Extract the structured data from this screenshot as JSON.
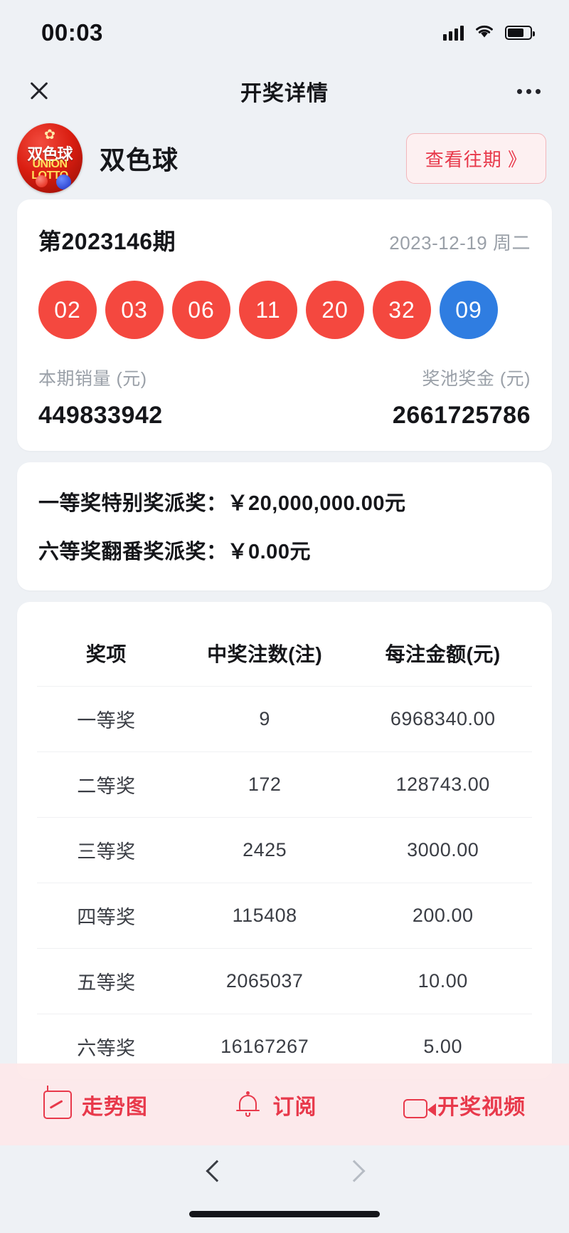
{
  "status_bar": {
    "time": "00:03",
    "signal_icon": "signal-bars-icon",
    "wifi_icon": "wifi-icon",
    "battery_icon": "battery-icon"
  },
  "nav": {
    "title": "开奖详情",
    "close_icon": "close-icon",
    "more_icon": "more-options-icon"
  },
  "brand": {
    "logo_star": "✿",
    "logo_cn": "双色球",
    "logo_en_line1": "UNION",
    "logo_en_line2": "LOTTO",
    "name": "双色球",
    "history_button": "查看往期 》"
  },
  "draw": {
    "issue": "第2023146期",
    "date": "2023-12-19 周二",
    "balls": [
      {
        "number": "02",
        "color": "red"
      },
      {
        "number": "03",
        "color": "red"
      },
      {
        "number": "06",
        "color": "red"
      },
      {
        "number": "11",
        "color": "red"
      },
      {
        "number": "20",
        "color": "red"
      },
      {
        "number": "32",
        "color": "red"
      },
      {
        "number": "09",
        "color": "blue"
      }
    ],
    "sales_label": "本期销量 (元)",
    "sales_value": "449833942",
    "pool_label": "奖池奖金 (元)",
    "pool_value": "2661725786"
  },
  "bonus": {
    "line1": "一等奖特别奖派奖：￥20,000,000.00元",
    "line2": "六等奖翻番奖派奖：￥0.00元"
  },
  "prize_table": {
    "headers": [
      "奖项",
      "中奖注数(注)",
      "每注金额(元)"
    ],
    "rows": [
      {
        "level": "一等奖",
        "count": "9",
        "amount": "6968340.00"
      },
      {
        "level": "二等奖",
        "count": "172",
        "amount": "128743.00"
      },
      {
        "level": "三等奖",
        "count": "2425",
        "amount": "3000.00"
      },
      {
        "level": "四等奖",
        "count": "115408",
        "amount": "200.00"
      },
      {
        "level": "五等奖",
        "count": "2065037",
        "amount": "10.00"
      },
      {
        "level": "六等奖",
        "count": "16167267",
        "amount": "5.00"
      }
    ]
  },
  "tabbar": {
    "items": [
      {
        "label": "走势图",
        "icon": "chart-icon"
      },
      {
        "label": "订阅",
        "icon": "bell-icon"
      },
      {
        "label": "开奖视频",
        "icon": "video-icon"
      }
    ],
    "accent_color": "#e8394b",
    "background_color": "#fde8e9"
  },
  "browser_nav": {
    "back_icon": "chevron-left-icon",
    "forward_icon": "chevron-right-icon",
    "home_indicator": "home-indicator"
  },
  "colors": {
    "red_ball": "#f4483f",
    "blue_ball": "#2f7de1",
    "accent": "#e8394b",
    "page_bg": "#eef1f5"
  }
}
